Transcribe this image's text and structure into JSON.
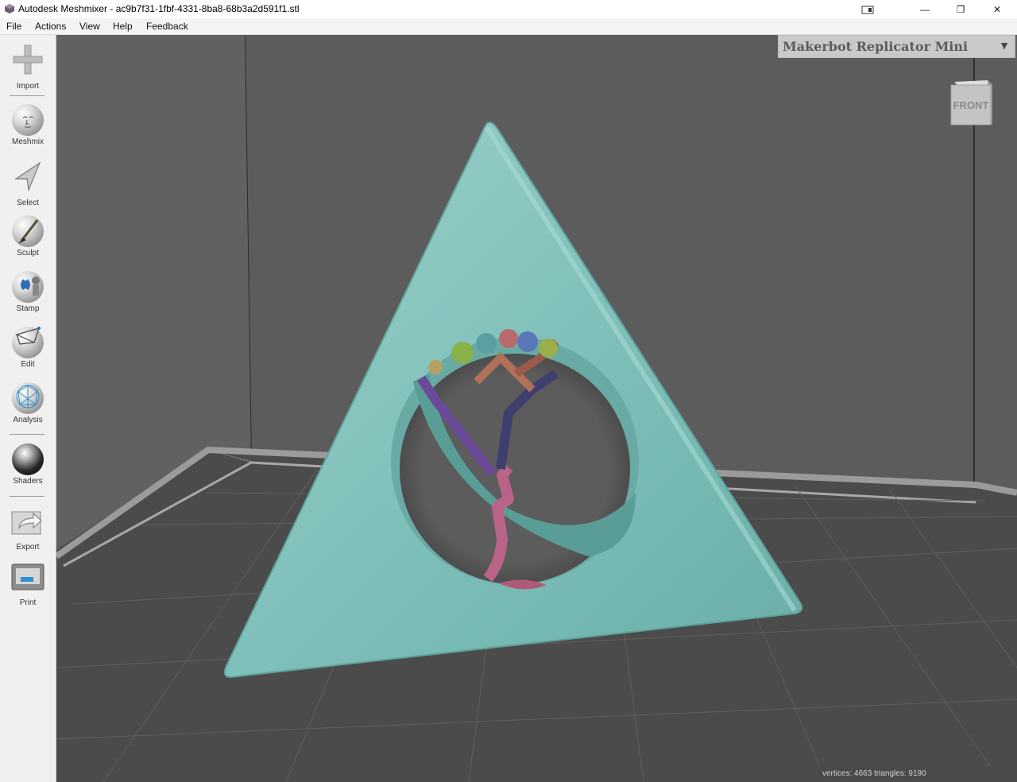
{
  "window": {
    "title": "Autodesk Meshmixer - ac9b7f31-1fbf-4331-8ba8-68b3a2d591f1.stl",
    "controls": {
      "snap_icon": "snap-layout-icon",
      "minimize": "—",
      "maximize": "❐",
      "close": "✕"
    }
  },
  "menu": {
    "items": [
      "File",
      "Actions",
      "View",
      "Help",
      "Feedback"
    ]
  },
  "toolbar": {
    "tools": [
      {
        "label": "Import",
        "icon": "plus-icon"
      },
      {
        "label": "Meshmix",
        "icon": "face-sphere-icon"
      },
      {
        "label": "Select",
        "icon": "arrow-select-icon"
      },
      {
        "label": "Sculpt",
        "icon": "brush-sphere-icon"
      },
      {
        "label": "Stamp",
        "icon": "stamp-sphere-icon"
      },
      {
        "label": "Edit",
        "icon": "edit-sphere-icon"
      },
      {
        "label": "Analysis",
        "icon": "analysis-sphere-icon"
      },
      {
        "label": "Shaders",
        "icon": "shader-ball-icon"
      },
      {
        "label": "Export",
        "icon": "export-icon"
      },
      {
        "label": "Print",
        "icon": "printer-icon"
      }
    ]
  },
  "viewport": {
    "printer_selected": "Makerbot Replicator Mini",
    "viewcube_label": "FRONT",
    "model_color": "#7bbcb6",
    "status": "vertices: 4663 triangles: 9190"
  }
}
